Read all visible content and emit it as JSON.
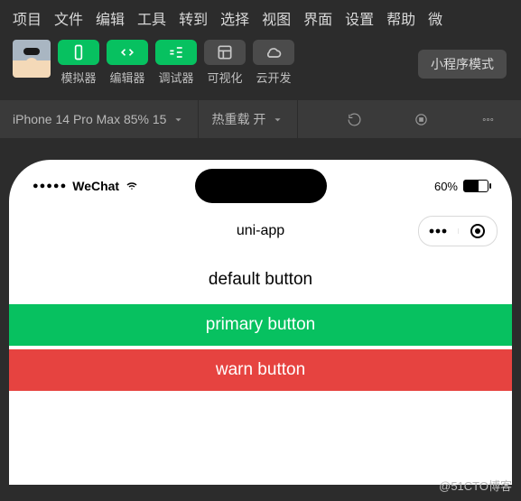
{
  "menubar": [
    "项目",
    "文件",
    "编辑",
    "工具",
    "转到",
    "选择",
    "视图",
    "界面",
    "设置",
    "帮助",
    "微"
  ],
  "toolbar": {
    "modes": [
      {
        "icon": "phone",
        "label": "模拟器",
        "active": true
      },
      {
        "icon": "code",
        "label": "编辑器",
        "active": true
      },
      {
        "icon": "debug",
        "label": "调试器",
        "active": true
      },
      {
        "icon": "layout",
        "label": "可视化",
        "active": false
      },
      {
        "icon": "cloud",
        "label": "云开发",
        "active": false
      }
    ],
    "miniprogram_mode": "小程序模式"
  },
  "device_row": {
    "device": "iPhone 14 Pro Max 85% 15",
    "reload": "热重载 开"
  },
  "simulator": {
    "carrier": "WeChat",
    "battery_pct": "60%",
    "page_title": "uni-app",
    "buttons": [
      {
        "style": "default",
        "label": "default button"
      },
      {
        "style": "primary",
        "label": "primary button"
      },
      {
        "style": "warn",
        "label": "warn button"
      }
    ]
  },
  "watermark": "@51CTO博客"
}
